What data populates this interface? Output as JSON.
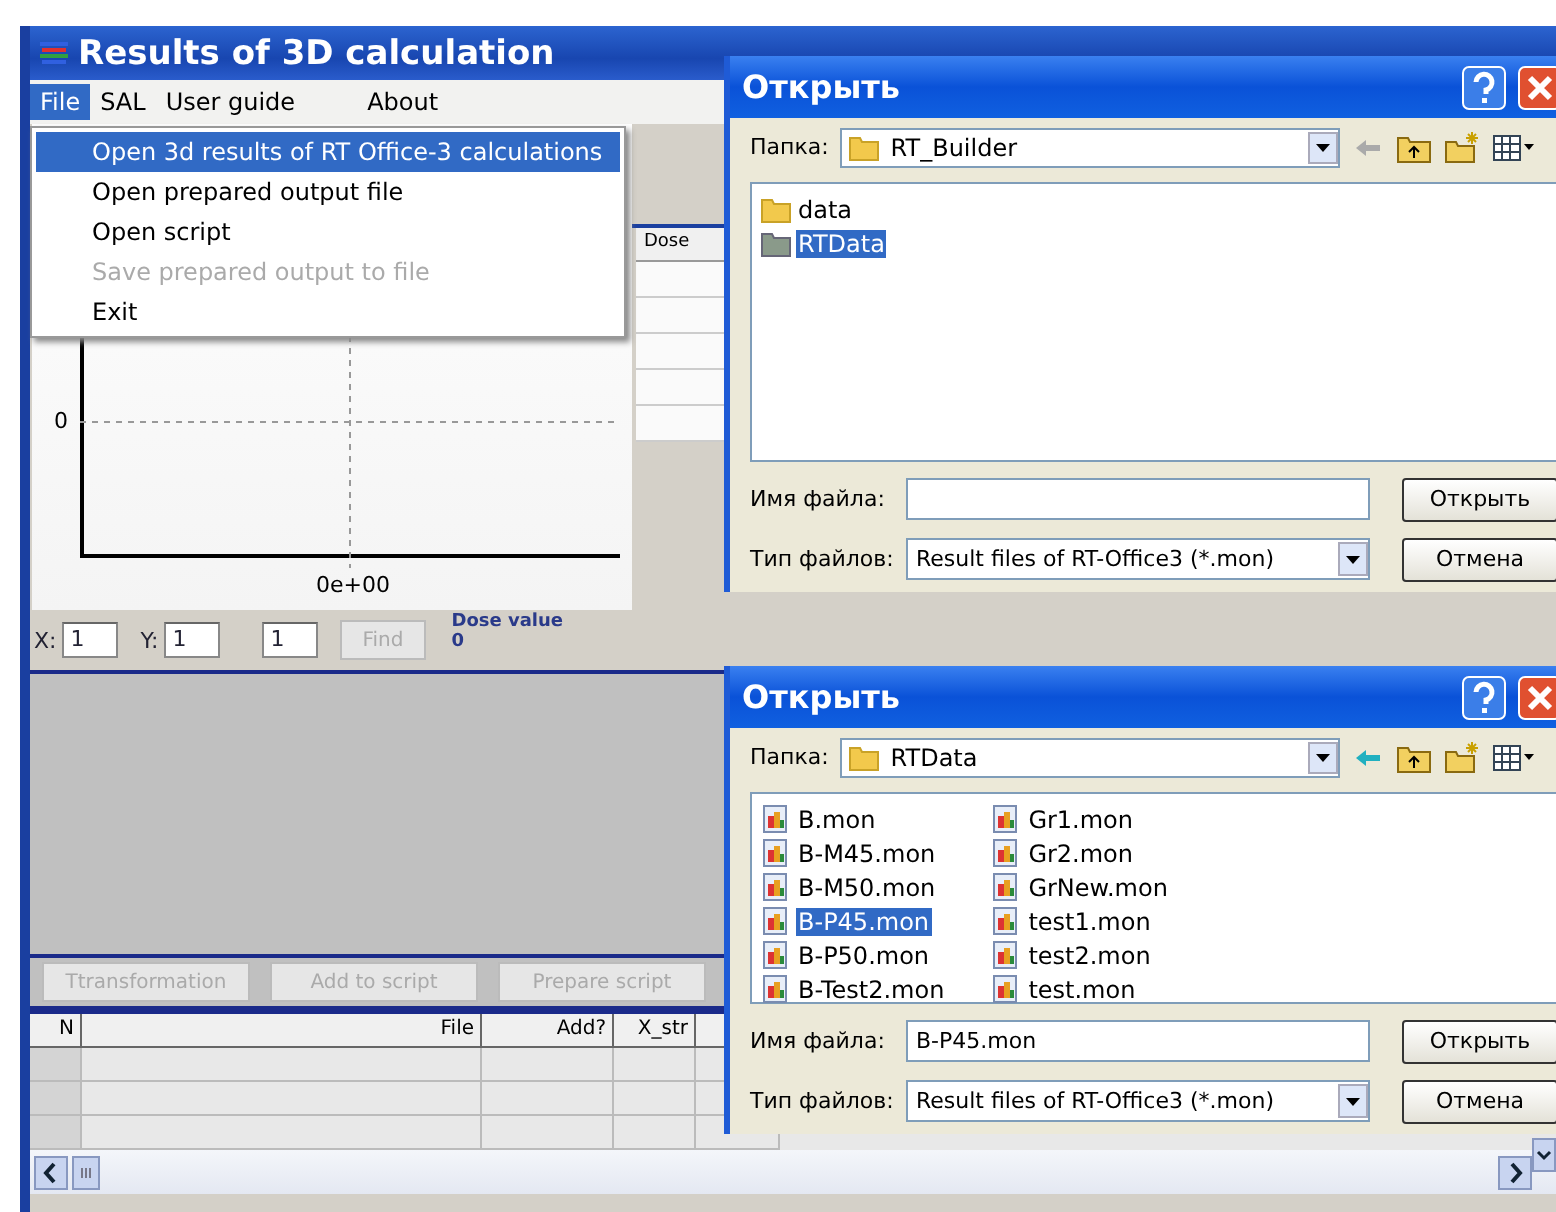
{
  "window": {
    "title": "Results of 3D calculation"
  },
  "menu_bar": [
    {
      "label": "File",
      "selected": true
    },
    {
      "label": "SAL",
      "selected": false
    },
    {
      "label": "User guide",
      "selected": false
    },
    {
      "label": "About",
      "selected": false
    }
  ],
  "file_menu": {
    "items": [
      {
        "label": "Open 3d results of  RT Office-3 calculations",
        "selected": true,
        "disabled": false
      },
      {
        "label": "Open prepared output file",
        "selected": false,
        "disabled": false
      },
      {
        "label": "Open script",
        "selected": false,
        "disabled": false
      },
      {
        "label": "Save prepared output to file",
        "selected": false,
        "disabled": true
      },
      {
        "label": "Exit",
        "selected": false,
        "disabled": false
      }
    ]
  },
  "plot": {
    "y_tick": "0",
    "x_tick": "0e+00"
  },
  "dose_grid": {
    "columns": [
      "Dose"
    ]
  },
  "coordinates": {
    "x_label": "X:",
    "x_value": "1",
    "y_label": "Y:",
    "y_value": "1",
    "z_value": "1",
    "find_button": {
      "label": "Find",
      "disabled": true
    },
    "dose_label": "Dose value",
    "dose_value": "0"
  },
  "actions": [
    {
      "label": "Ttransformation",
      "disabled": true
    },
    {
      "label": "Add to script",
      "disabled": true
    },
    {
      "label": "Prepare script",
      "disabled": true
    }
  ],
  "script_table": {
    "columns": [
      "N",
      "File",
      "Add?",
      "X_str"
    ]
  },
  "dialogs": [
    {
      "title": "Открыть",
      "folder_label": "Папка:",
      "folder": "RT_Builder",
      "files": [
        {
          "name": "data",
          "kind": "folder",
          "selected": false
        },
        {
          "name": "RTData",
          "kind": "folder",
          "selected": true
        }
      ],
      "filename_label": "Имя файла:",
      "filetype_label": "Тип файлов:",
      "filetype": "Result files of RT-Office3 (*.mon)",
      "open_button": "Открыть",
      "cancel_button": "Отмена"
    },
    {
      "title": "Открыть",
      "folder_label": "Папка:",
      "folder": "RTData",
      "files": [
        {
          "name": "B.mon",
          "kind": "file",
          "selected": false
        },
        {
          "name": "B-M45.mon",
          "kind": "file",
          "selected": false
        },
        {
          "name": "B-M50.mon",
          "kind": "file",
          "selected": false
        },
        {
          "name": "B-P45.mon",
          "kind": "file",
          "selected": true
        },
        {
          "name": "B-P50.mon",
          "kind": "file",
          "selected": false
        },
        {
          "name": "B-Test2.mon",
          "kind": "file",
          "selected": false
        },
        {
          "name": "Gr1.mon",
          "kind": "file",
          "selected": false
        },
        {
          "name": "Gr2.mon",
          "kind": "file",
          "selected": false
        },
        {
          "name": "GrNew.mon",
          "kind": "file",
          "selected": false
        },
        {
          "name": "test1.mon",
          "kind": "file",
          "selected": false
        },
        {
          "name": "test2.mon",
          "kind": "file",
          "selected": false
        },
        {
          "name": "test.mon",
          "kind": "file",
          "selected": false
        }
      ],
      "filename_label": "Имя файла:",
      "filename": "B-P45.mon",
      "filetype_label": "Тип файлов:",
      "filetype": "Result files of RT-Office3 (*.mon)",
      "open_button": "Открыть",
      "cancel_button": "Отмена"
    }
  ]
}
